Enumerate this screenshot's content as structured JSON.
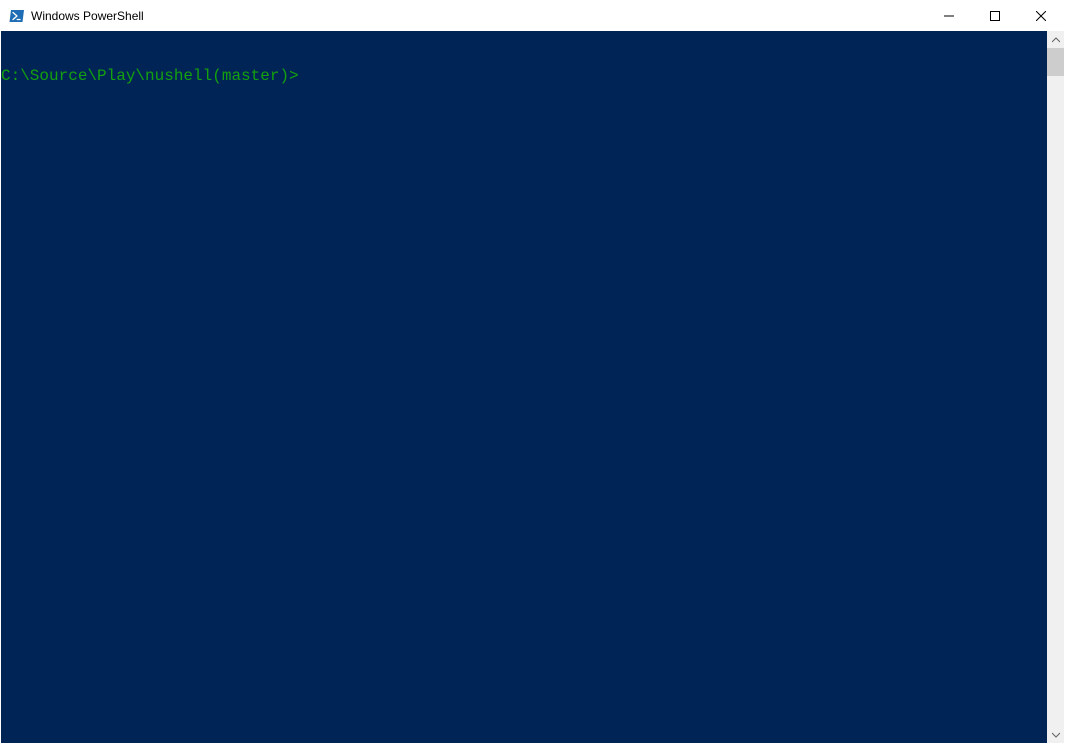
{
  "titlebar": {
    "title": "Windows PowerShell"
  },
  "terminal": {
    "prompt": "C:\\Source\\Play\\nushell(master)>"
  }
}
